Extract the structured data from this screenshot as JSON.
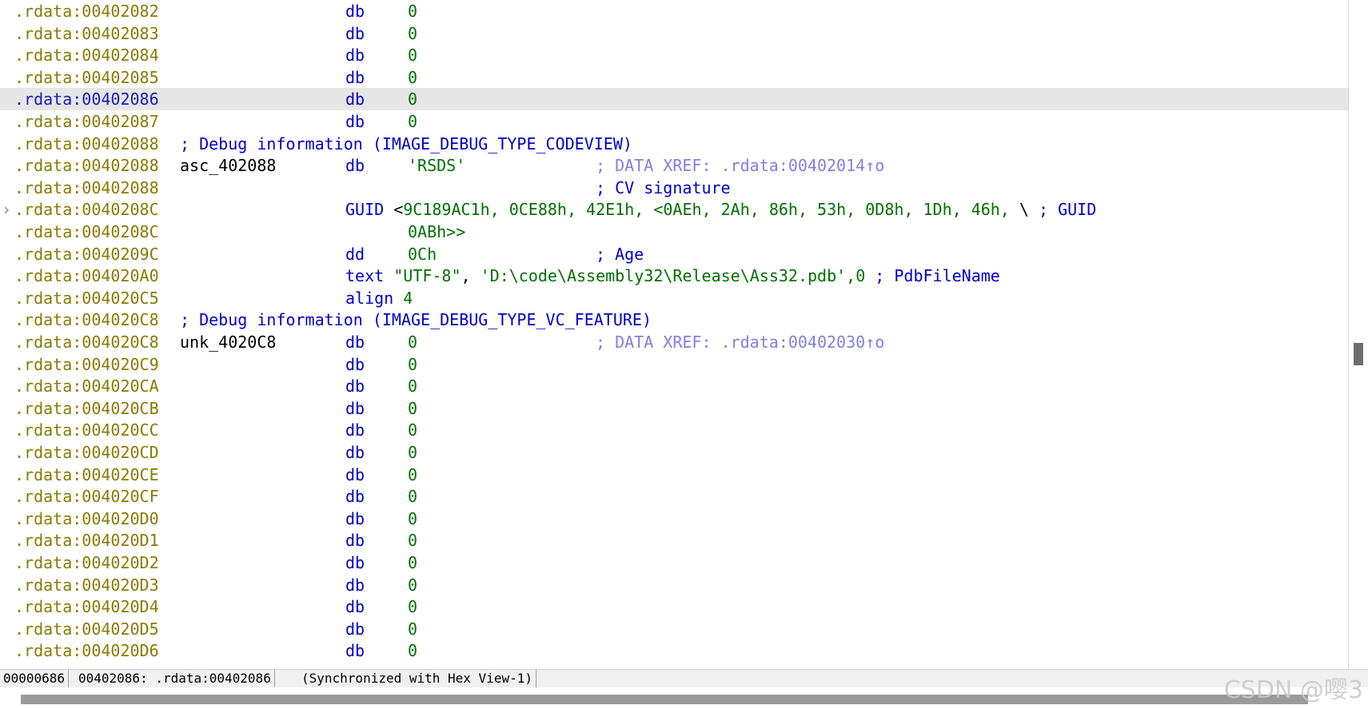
{
  "lines": [
    {
      "address": ".rdata:00402082",
      "mnemonic": "db",
      "operand": "0"
    },
    {
      "address": ".rdata:00402083",
      "mnemonic": "db",
      "operand": "0"
    },
    {
      "address": ".rdata:00402084",
      "mnemonic": "db",
      "operand": "0"
    },
    {
      "address": ".rdata:00402085",
      "mnemonic": "db",
      "operand": "0"
    },
    {
      "address": ".rdata:00402086",
      "mnemonic": "db",
      "operand": "0",
      "selected": true
    },
    {
      "address": ".rdata:00402087",
      "mnemonic": "db",
      "operand": "0"
    },
    {
      "address": ".rdata:00402088",
      "full_comment": "; Debug information (IMAGE_DEBUG_TYPE_CODEVIEW)"
    },
    {
      "address": ".rdata:00402088",
      "label": "asc_402088",
      "mnemonic": "db",
      "operand": "'RSDS'",
      "xref": "; DATA XREF: .rdata:00402014↑o"
    },
    {
      "address": ".rdata:00402088",
      "comment": "; CV signature"
    },
    {
      "address": ".rdata:0040208C",
      "arrow": "›",
      "guid": {
        "kw": "GUID",
        "open": "<",
        "values": "9C189AC1h, 0CE88h, 42E1h, <0AEh, 2Ah, 86h, 53h, 0D8h, 1Dh, 46h,",
        "cont": " \\ ",
        "cmt": "; GUID"
      }
    },
    {
      "address": ".rdata:0040208C",
      "guid_tail": "0ABh>>"
    },
    {
      "address": ".rdata:0040209C",
      "mnemonic": "dd",
      "operand": "0Ch",
      "comment": "; Age"
    },
    {
      "address": ".rdata:004020A0",
      "text_line": {
        "kw": "text",
        "s1": "\"UTF-8\"",
        "sep": ", ",
        "s2": "'D:\\code\\Assembly32\\Release\\Ass32.pdb'",
        "tail": ",0",
        "cmt": " ; PdbFileName"
      }
    },
    {
      "address": ".rdata:004020C5",
      "align_line": {
        "kw": "align",
        "val": "4"
      }
    },
    {
      "address": ".rdata:004020C8",
      "full_comment": "; Debug information (IMAGE_DEBUG_TYPE_VC_FEATURE)"
    },
    {
      "address": ".rdata:004020C8",
      "label": "unk_4020C8",
      "mnemonic": "db",
      "operand": "0",
      "xref": "; DATA XREF: .rdata:00402030↑o"
    },
    {
      "address": ".rdata:004020C9",
      "mnemonic": "db",
      "operand": "0"
    },
    {
      "address": ".rdata:004020CA",
      "mnemonic": "db",
      "operand": "0"
    },
    {
      "address": ".rdata:004020CB",
      "mnemonic": "db",
      "operand": "0"
    },
    {
      "address": ".rdata:004020CC",
      "mnemonic": "db",
      "operand": "0"
    },
    {
      "address": ".rdata:004020CD",
      "mnemonic": "db",
      "operand": "0"
    },
    {
      "address": ".rdata:004020CE",
      "mnemonic": "db",
      "operand": "0"
    },
    {
      "address": ".rdata:004020CF",
      "mnemonic": "db",
      "operand": "0"
    },
    {
      "address": ".rdata:004020D0",
      "mnemonic": "db",
      "operand": "0"
    },
    {
      "address": ".rdata:004020D1",
      "mnemonic": "db",
      "operand": "0"
    },
    {
      "address": ".rdata:004020D2",
      "mnemonic": "db",
      "operand": "0"
    },
    {
      "address": ".rdata:004020D3",
      "mnemonic": "db",
      "operand": "0"
    },
    {
      "address": ".rdata:004020D4",
      "mnemonic": "db",
      "operand": "0"
    },
    {
      "address": ".rdata:004020D5",
      "mnemonic": "db",
      "operand": "0"
    },
    {
      "address": ".rdata:004020D6",
      "mnemonic": "db",
      "operand": "0"
    }
  ],
  "status": {
    "offset": "00000686",
    "ea": "00402086: .rdata:00402086",
    "sync": "(Synchronized with Hex View-1)"
  },
  "watermark": "CSDN @嘤3"
}
